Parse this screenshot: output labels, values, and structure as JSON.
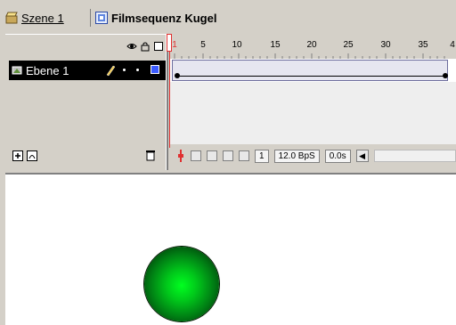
{
  "breadcrumb": {
    "scene_label": "Szene 1",
    "clip_label": "Filmsequenz Kugel"
  },
  "layers": [
    {
      "name": "Ebene 1"
    }
  ],
  "ruler": {
    "ticks": [
      "1",
      "5",
      "10",
      "15",
      "20",
      "25",
      "30",
      "35",
      "4"
    ]
  },
  "status": {
    "current_frame": "1",
    "frame_rate": "12.0 BpS",
    "elapsed": "0.0s"
  },
  "icons": {
    "scene": "clapperboard-icon",
    "clip": "movieclip-icon",
    "layer": "layer-icon",
    "pencil": "pencil-icon",
    "trash": "trash-icon"
  },
  "colors": {
    "ball_center": "#00ff20",
    "ball_edge": "#001e04",
    "playhead": "#e03030",
    "outline_square": "#3b5bff"
  }
}
